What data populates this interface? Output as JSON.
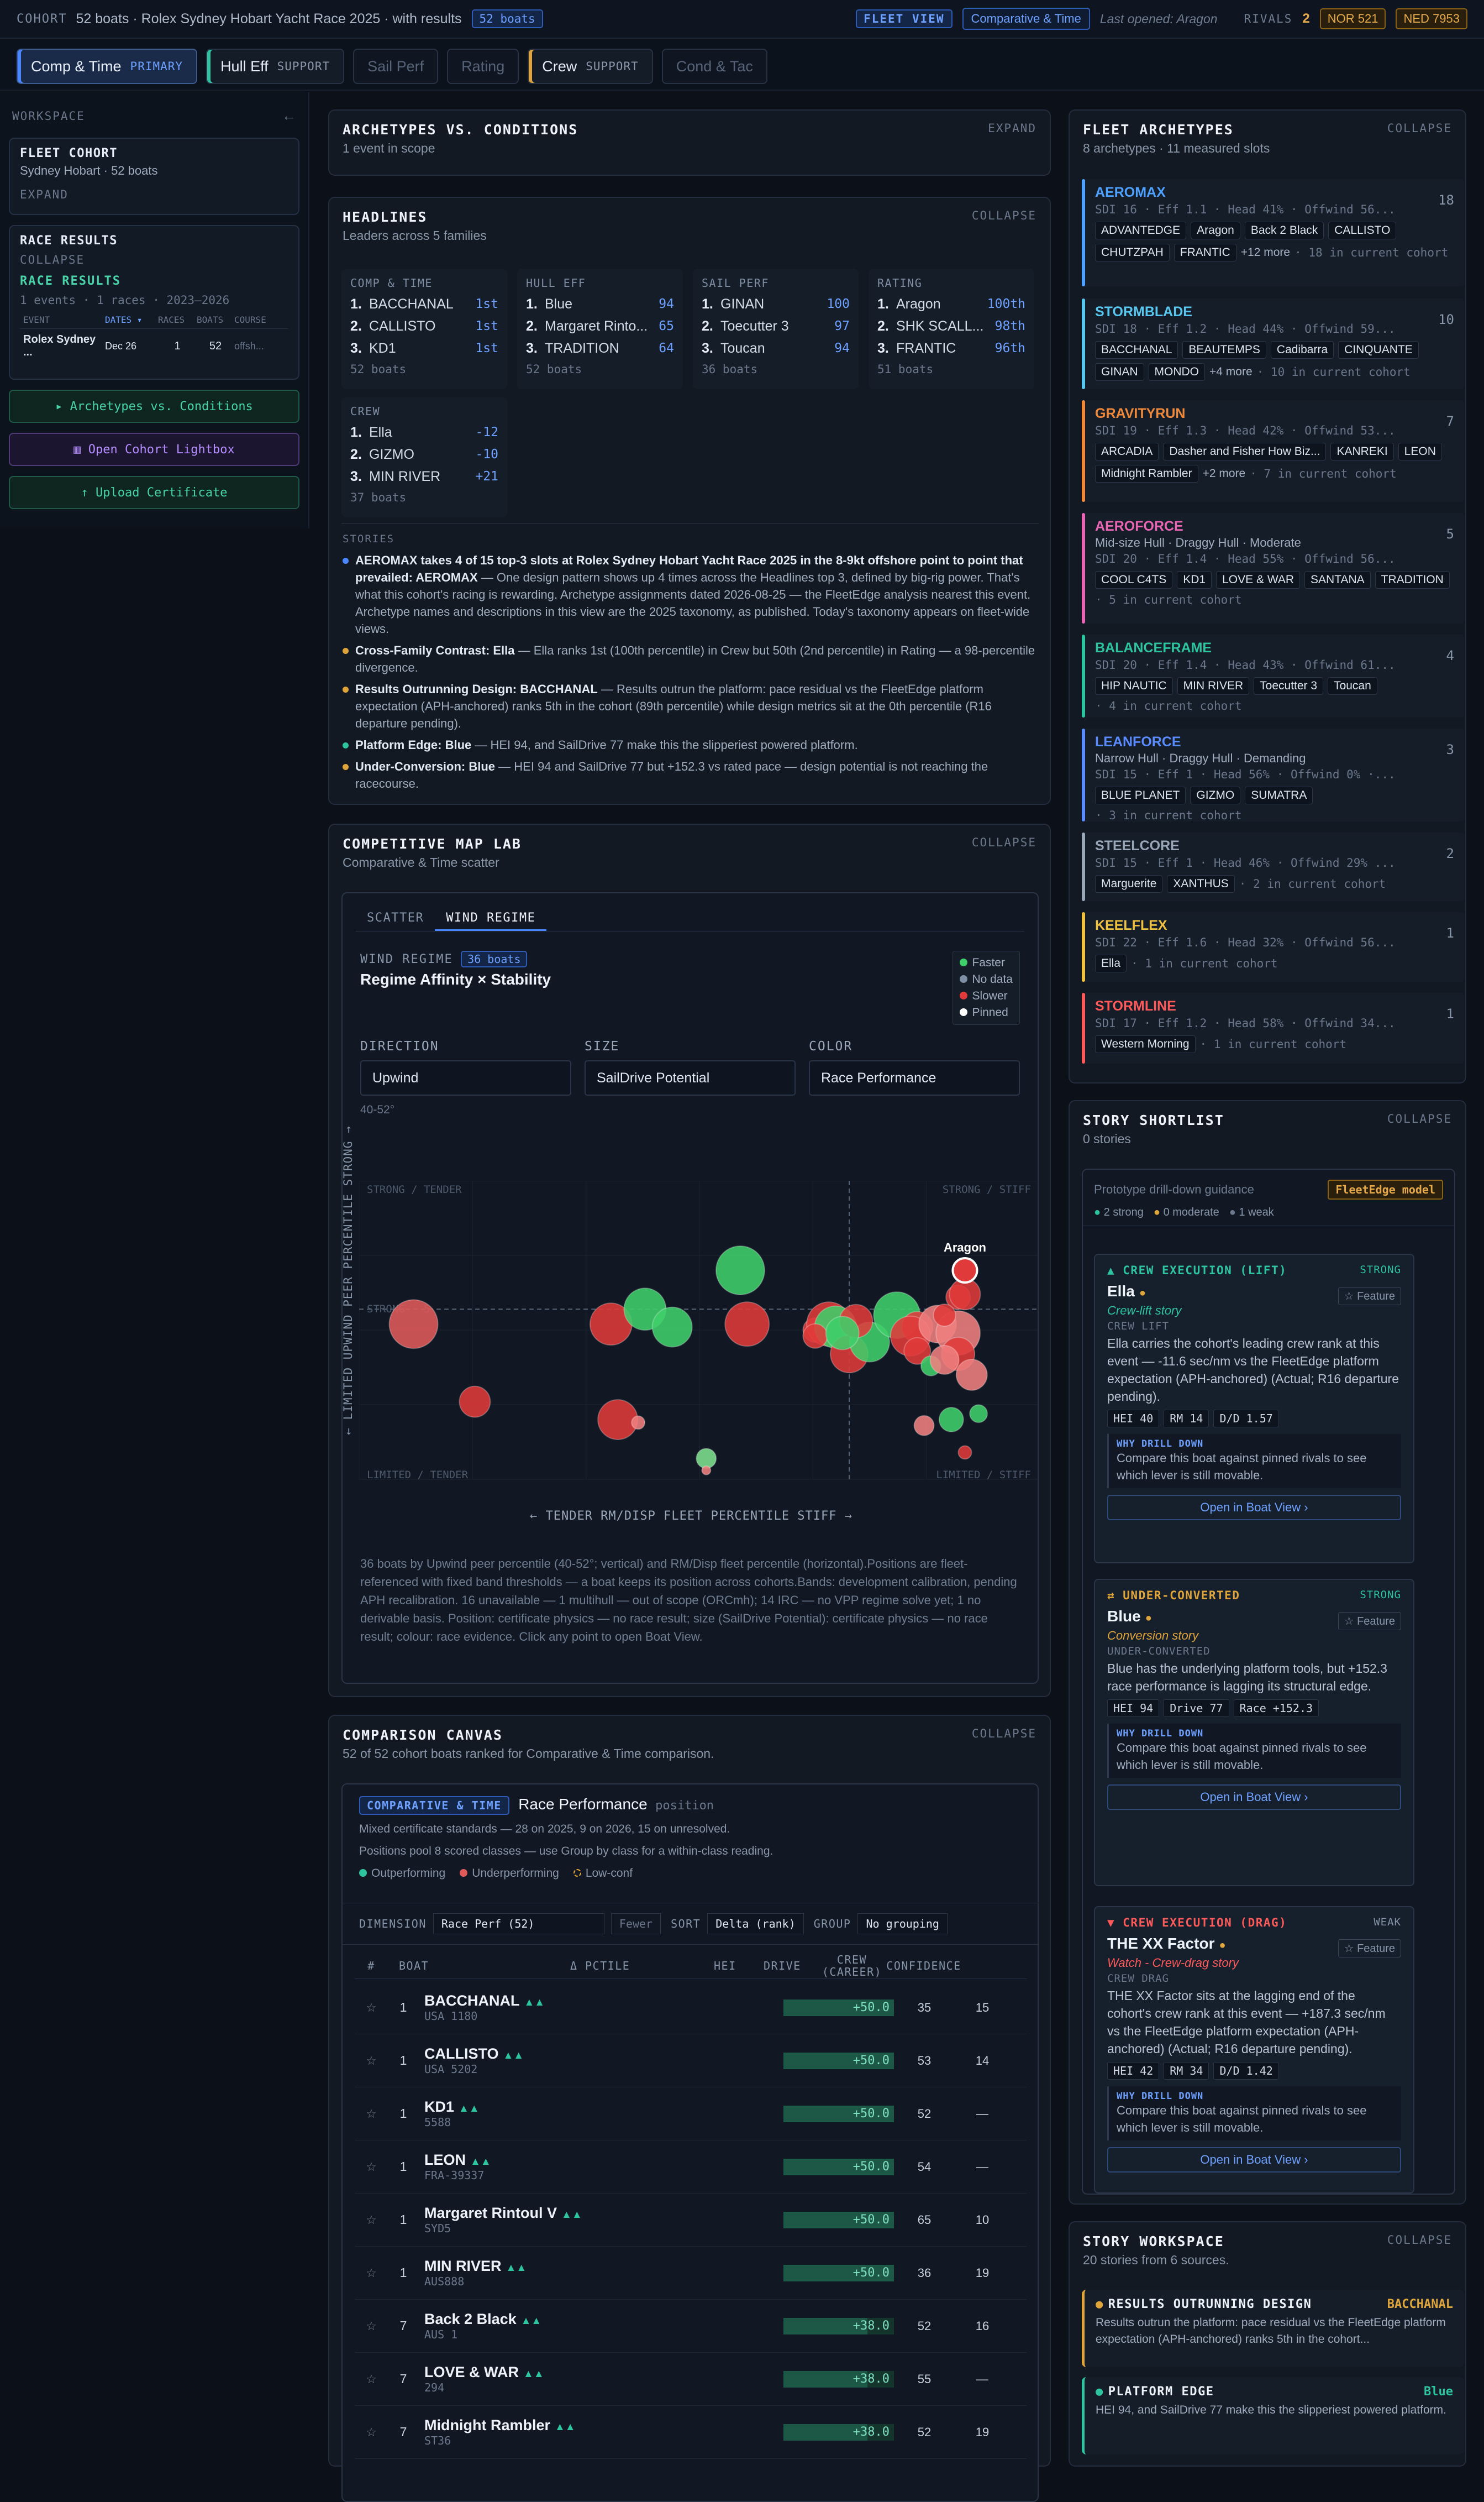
{
  "topbar": {
    "tag": "COHORT",
    "title": "52 boats · Rolex Sydney Hobart Yacht Race 2025 · with results",
    "boats_pill": "52 boats",
    "fleet_view": "FLEET VIEW",
    "comparative": "Comparative & Time",
    "last_opened": "Last opened: Aragon",
    "rivals_label": "RIVALS",
    "rivals_count": "2",
    "rival1": "NOR 521",
    "rival2": "NED 7953"
  },
  "tabs": [
    {
      "label": "Comp & Time",
      "sub": "PRIMARY"
    },
    {
      "label": "Hull Eff",
      "sub": "SUPPORT"
    },
    {
      "label": "Sail Perf",
      "sub": ""
    },
    {
      "label": "Rating",
      "sub": ""
    },
    {
      "label": "Crew",
      "sub": "SUPPORT"
    },
    {
      "label": "Cond & Tac",
      "sub": ""
    }
  ],
  "sidebar": {
    "workspace": "WORKSPACE",
    "collapse_icon": "←",
    "fleet_cohort": {
      "title": "FLEET COHORT",
      "sub": "Sydney Hobart · 52 boats",
      "expand": "EXPAND"
    },
    "race_results": {
      "title": "RACE RESULTS",
      "collapse": "COLLAPSE",
      "label": "RACE RESULTS",
      "meta": "1 events · 1 races · 2023–2026",
      "cols": [
        "EVENT",
        "DATES ▾",
        "RACES",
        "BOATS",
        "COURSE"
      ],
      "row": [
        "Rolex Sydney ...",
        "Dec 26",
        "1",
        "52",
        "offsh..."
      ]
    },
    "btn_archetypes": "▸ Archetypes vs. Conditions",
    "btn_lightbox": "▥ Open Cohort Lightbox",
    "btn_upload": "↑ Upload Certificate"
  },
  "archetypes_panel": {
    "title": "ARCHETYPES VS. CONDITIONS",
    "action": "EXPAND",
    "sub": "1 event in scope"
  },
  "headlines": {
    "title": "HEADLINES",
    "action": "COLLAPSE",
    "sub": "Leaders across 5 families",
    "cards": [
      {
        "h": "COMP & TIME",
        "rows": [
          [
            "1.",
            "BACCHANAL",
            "1st"
          ],
          [
            "2.",
            "CALLISTO",
            "1st"
          ],
          [
            "3.",
            "KD1",
            "1st"
          ]
        ],
        "f": "52 boats"
      },
      {
        "h": "HULL EFF",
        "rows": [
          [
            "1.",
            "Blue",
            "94"
          ],
          [
            "2.",
            "Margaret Rinto...",
            "65"
          ],
          [
            "3.",
            "TRADITION",
            "64"
          ]
        ],
        "f": "52 boats"
      },
      {
        "h": "SAIL PERF",
        "rows": [
          [
            "1.",
            "GINAN",
            "100"
          ],
          [
            "2.",
            "Toecutter 3",
            "97"
          ],
          [
            "3.",
            "Toucan",
            "94"
          ]
        ],
        "f": "36 boats"
      },
      {
        "h": "RATING",
        "rows": [
          [
            "1.",
            "Aragon",
            "100th"
          ],
          [
            "2.",
            "SHK SCALL...",
            "98th"
          ],
          [
            "3.",
            "FRANTIC",
            "96th"
          ]
        ],
        "f": "51 boats"
      },
      {
        "h": "CREW",
        "rows": [
          [
            "1.",
            "Ella",
            "-12"
          ],
          [
            "2.",
            "GIZMO",
            "-10"
          ],
          [
            "3.",
            "MIN RIVER",
            "+21"
          ]
        ],
        "f": "37 boats"
      }
    ],
    "stories_label": "STORIES",
    "stories": [
      {
        "bold": "AEROMAX takes 4 of 15 top-3 slots at Rolex Sydney Hobart Yacht Race 2025 in the 8-9kt offshore point to point that prevailed: AEROMAX",
        "text": " — One design pattern shows up 4 times across the Headlines top 3, defined by big-rig power. That's what this cohort's racing is rewarding. Archetype assignments dated 2026-08-25 — the FleetEdge analysis nearest this event. Archetype names and descriptions in this view are the 2025 taxonomy, as published. Today's taxonomy appears on fleet-wide views.",
        "color": "#4a86ff"
      },
      {
        "bold": "Cross-Family Contrast: Ella",
        "text": " — Ella ranks 1st (100th percentile) in Crew but 50th (2nd percentile) in Rating — a 98-percentile divergence.",
        "color": "#e0a53a"
      },
      {
        "bold": "Results Outrunning Design: BACCHANAL",
        "text": " — Results outrun the platform: pace residual vs the FleetEdge platform expectation (APH-anchored) ranks 5th in the cohort (89th percentile) while design metrics sit at the 0th percentile (R16 departure pending).",
        "color": "#e0a53a"
      },
      {
        "bold": "Platform Edge: Blue",
        "text": " — HEI 94, and SailDrive 77 make this the slipperiest powered platform.",
        "color": "#2ec4a0"
      },
      {
        "bold": "Under-Conversion: Blue",
        "text": " — HEI 94 and SailDrive 77 but +152.3 vs rated pace — design potential is not reaching the racecourse.",
        "color": "#e0a53a"
      }
    ]
  },
  "map": {
    "title": "COMPETITIVE MAP LAB",
    "action": "COLLAPSE",
    "sub": "Comparative & Time scatter",
    "tab1": "SCATTER",
    "tab2": "WIND REGIME",
    "regime_label": "WIND REGIME",
    "regime_count": "36 boats",
    "regime_title": "Regime Affinity × Stability",
    "legend": [
      "Faster",
      "No data",
      "Slower",
      "Pinned"
    ],
    "direction_label": "DIRECTION",
    "direction": "Upwind",
    "size_label": "SIZE",
    "size": "SailDrive Potential",
    "color_label": "COLOR",
    "color": "Race Performance",
    "range": "40-52°",
    "ylabel": "← LIMITED UPWIND PEER PERCENTILE STRONG →",
    "xlabel": "← TENDER RM/DISP FLEET PERCENTILE STIFF →",
    "q_tl": "STRONG / TENDER",
    "q_tr": "STRONG / STIFF",
    "q_bl": "LIMITED / TENDER",
    "q_br": "LIMITED / STIFF",
    "mid": "STRONG · 5",
    "pin_label": "Aragon",
    "note": "36 boats by Upwind peer percentile (40-52°; vertical) and RM/Disp fleet percentile (horizontal).Positions are fleet-referenced with fixed band thresholds — a boat keeps its position across cohorts.Bands: development calibration, pending APH recalibration. 16 unavailable — 1 multihull — out of scope (ORCmh); 14 IRC — no VPP regime solve yet; 1 no derivable basis. Position: certificate physics — no race result; size (SailDrive Potential): certificate physics — no race result; colour: race evidence. Click any point to open Boat View."
  },
  "chart_data": {
    "type": "scatter",
    "xlabel": "TENDER RM/DISP FLEET PERCENTILE STIFF",
    "ylabel": "LIMITED UPWIND PEER PERCENTILE STRONG",
    "xlim": [
      0,
      100
    ],
    "ylim": [
      0,
      100
    ],
    "points": [
      {
        "x": 8,
        "y": 52,
        "r": 44,
        "c": "#e05a5a"
      },
      {
        "x": 37,
        "y": 52,
        "r": 38,
        "c": "#e03a3a"
      },
      {
        "x": 42,
        "y": 57,
        "r": 38,
        "c": "#3fcf6a"
      },
      {
        "x": 46,
        "y": 51,
        "r": 36,
        "c": "#3fcf6a"
      },
      {
        "x": 56,
        "y": 70,
        "r": 44,
        "c": "#3fcf6a"
      },
      {
        "x": 57,
        "y": 52,
        "r": 40,
        "c": "#e03a3a"
      },
      {
        "x": 17,
        "y": 26,
        "r": 28,
        "c": "#e03a3a"
      },
      {
        "x": 38,
        "y": 20,
        "r": 36,
        "c": "#e03a3a"
      },
      {
        "x": 41,
        "y": 19,
        "r": 12,
        "c": "#f08080"
      },
      {
        "x": 51,
        "y": 7,
        "r": 18,
        "c": "#7ee08e"
      },
      {
        "x": 51,
        "y": 3,
        "r": 8,
        "c": "#f08080"
      },
      {
        "x": 67,
        "y": 50,
        "r": 22,
        "c": "#e03a3a"
      },
      {
        "x": 69,
        "y": 52,
        "r": 40,
        "c": "#e03a3a"
      },
      {
        "x": 70,
        "y": 51,
        "r": 38,
        "c": "#3fcf6a"
      },
      {
        "x": 72,
        "y": 42,
        "r": 34,
        "c": "#e03a3a"
      },
      {
        "x": 75,
        "y": 46,
        "r": 36,
        "c": "#3fcf6a"
      },
      {
        "x": 79,
        "y": 55,
        "r": 42,
        "c": "#3fcf6a"
      },
      {
        "x": 82,
        "y": 51,
        "r": 28,
        "c": "#e03a3a"
      },
      {
        "x": 81,
        "y": 48,
        "r": 36,
        "c": "#e03a3a"
      },
      {
        "x": 82,
        "y": 43,
        "r": 24,
        "c": "#e03a3a"
      },
      {
        "x": 85,
        "y": 52,
        "r": 34,
        "c": "#f08080"
      },
      {
        "x": 88,
        "y": 61,
        "r": 22,
        "c": "#e03a3a"
      },
      {
        "x": 88,
        "y": 49,
        "r": 40,
        "c": "#f08080"
      },
      {
        "x": 88,
        "y": 42,
        "r": 30,
        "c": "#e03a3a"
      },
      {
        "x": 84,
        "y": 38,
        "r": 18,
        "c": "#3fcf6a"
      },
      {
        "x": 83,
        "y": 18,
        "r": 18,
        "c": "#f08080"
      },
      {
        "x": 87,
        "y": 20,
        "r": 22,
        "c": "#3fcf6a"
      },
      {
        "x": 91,
        "y": 22,
        "r": 16,
        "c": "#3fcf6a"
      },
      {
        "x": 89,
        "y": 9,
        "r": 12,
        "c": "#e03a3a"
      },
      {
        "x": 67,
        "y": 48,
        "r": 22,
        "c": "#e03a3a"
      },
      {
        "x": 73,
        "y": 53,
        "r": 30,
        "c": "#e03a3a"
      },
      {
        "x": 86,
        "y": 40,
        "r": 26,
        "c": "#f08080"
      },
      {
        "x": 90,
        "y": 35,
        "r": 28,
        "c": "#f08080"
      },
      {
        "x": 86,
        "y": 55,
        "r": 20,
        "c": "#e03a3a"
      },
      {
        "x": 89,
        "y": 62,
        "r": 28,
        "c": "#e03a3a"
      },
      {
        "x": 71,
        "y": 49,
        "r": 30,
        "c": "#3fcf6a"
      }
    ]
  },
  "comparison": {
    "title": "COMPARISON CANVAS",
    "action": "COLLAPSE",
    "sub": "52 of 52 cohort boats ranked for Comparative & Time comparison.",
    "mode": "COMPARATIVE & TIME",
    "metric": "Race Performance",
    "metric_sub": "position",
    "note1": "Mixed certificate standards — 28 on 2025, 9 on 2026, 15 on unresolved.",
    "note2": "Positions pool 8 scored classes — use Group by class for a within-class reading.",
    "leg1": "Outperforming",
    "leg2": "Underperforming",
    "leg3": "Low-conf",
    "dim_label": "DIMENSION",
    "dim": "Race Perf (52)",
    "fewer": "Fewer",
    "sort_label": "SORT",
    "sort": "Delta (rank)",
    "group_label": "GROUP",
    "group": "No grouping",
    "cols": [
      "#",
      "BOAT",
      "Δ PCTILE",
      "HEI",
      "DRIVE",
      "CREW (CAREER)",
      "CONFIDENCE"
    ],
    "rows": [
      {
        "rank": "1",
        "boat": "BACCHANAL",
        "sail": "USA 1180",
        "val": "+50.0",
        "crew": "35",
        "conf": "15",
        "fill": 100
      },
      {
        "rank": "1",
        "boat": "CALLISTO",
        "sail": "USA 5202",
        "val": "+50.0",
        "crew": "53",
        "conf": "14",
        "fill": 100
      },
      {
        "rank": "1",
        "boat": "KD1",
        "sail": "5588",
        "val": "+50.0",
        "crew": "52",
        "conf": "—",
        "fill": 100
      },
      {
        "rank": "1",
        "boat": "LEON",
        "sail": "FRA-39337",
        "val": "+50.0",
        "crew": "54",
        "conf": "—",
        "fill": 100
      },
      {
        "rank": "1",
        "boat": "Margaret Rintoul V",
        "sail": "SYD5",
        "val": "+50.0",
        "crew": "65",
        "conf": "10",
        "fill": 100
      },
      {
        "rank": "1",
        "boat": "MIN RIVER",
        "sail": "AUS888",
        "val": "+50.0",
        "crew": "36",
        "conf": "19",
        "fill": 100
      },
      {
        "rank": "7",
        "boat": "Back 2 Black",
        "sail": "AUS 1",
        "val": "+38.0",
        "crew": "52",
        "conf": "16",
        "fill": 76
      },
      {
        "rank": "7",
        "boat": "LOVE & WAR",
        "sail": "294",
        "val": "+38.0",
        "crew": "55",
        "conf": "—",
        "fill": 76
      },
      {
        "rank": "7",
        "boat": "Midnight Rambler",
        "sail": "ST36",
        "val": "+38.0",
        "crew": "52",
        "conf": "19",
        "fill": 76
      }
    ]
  },
  "fleet_arch": {
    "title": "FLEET ARCHETYPES",
    "action": "COLLAPSE",
    "sub": "8 archetypes · 11 measured slots",
    "items": [
      {
        "name": "AEROMAX",
        "color": "#4ea1ff",
        "meta": "SDI 16 · Eff 1.1 · Head 41% · Offwind 56...",
        "count": "18",
        "chips": [
          "ADVANTEDGE",
          "Aragon",
          "Back 2 Black",
          "CALLISTO",
          "CHUTZPAH",
          "FRANTIC"
        ],
        "more": "+12 more",
        "cur": "18 in current cohort"
      },
      {
        "name": "STORMBLADE",
        "color": "#58c8f0",
        "meta": "SDI 18 · Eff 1.2 · Head 44% · Offwind 59...",
        "count": "10",
        "chips": [
          "BACCHANAL",
          "BEAUTEMPS",
          "Cadibarra",
          "CINQUANTE",
          "GINAN",
          "MONDO"
        ],
        "more": "+4 more",
        "cur": "10 in current cohort"
      },
      {
        "name": "GRAVITYRUN",
        "color": "#f0883a",
        "meta": "SDI 19 · Eff 1.3 · Head 42% · Offwind 53...",
        "count": "7",
        "chips": [
          "ARCADIA",
          "Dasher and Fisher How Biz...",
          "KANREKI",
          "LEON",
          "Midnight Rambler"
        ],
        "more": "+2 more",
        "cur": "7 in current cohort"
      },
      {
        "name": "AEROFORCE",
        "color": "#e866b4",
        "desc": "Mid-size Hull · Draggy Hull · Moderate",
        "meta": "SDI 20 · Eff 1.4 · Head 55% · Offwind 56...",
        "count": "5",
        "chips": [
          "COOL C4TS",
          "KD1",
          "LOVE & WAR",
          "SANTANA",
          "TRADITION"
        ],
        "more": "",
        "cur": "5 in current cohort"
      },
      {
        "name": "BALANCEFRAME",
        "color": "#2ec4a0",
        "meta": "SDI 20 · Eff 1.4 · Head 43% · Offwind 61...",
        "count": "4",
        "chips": [
          "HIP NAUTIC",
          "MIN RIVER",
          "Toecutter 3",
          "Toucan"
        ],
        "more": "",
        "cur": "4 in current cohort"
      },
      {
        "name": "LEANFORCE",
        "color": "#5b8cff",
        "desc": "Narrow Hull · Draggy Hull · Demanding",
        "meta": "SDI 15 · Eff 1 · Head 56% · Offwind 0% ·...",
        "count": "3",
        "chips": [
          "BLUE PLANET",
          "GIZMO",
          "SUMATRA"
        ],
        "more": "",
        "cur": "3 in current cohort"
      },
      {
        "name": "STEELCORE",
        "color": "#9aa7b8",
        "meta": "SDI 15 · Eff 1 · Head 46% · Offwind 29% ...",
        "count": "2",
        "chips": [
          "Marguerite",
          "XANTHUS"
        ],
        "more": "",
        "cur": "2 in current cohort"
      },
      {
        "name": "KEELFLEX",
        "color": "#f0c040",
        "meta": "SDI 22 · Eff 1.6 · Head 32% · Offwind 56...",
        "count": "1",
        "chips": [
          "Ella"
        ],
        "more": "",
        "cur": "1 in current cohort"
      },
      {
        "name": "STORMLINE",
        "color": "#ff5a5a",
        "meta": "SDI 17 · Eff 1.2 · Head 58% · Offwind 34...",
        "count": "1",
        "chips": [
          "Western Morning"
        ],
        "more": "",
        "cur": "1 in current cohort"
      }
    ]
  },
  "shortlist": {
    "title": "STORY SHORTLIST",
    "action": "COLLAPSE",
    "sub": "0 stories",
    "guidance": "Prototype drill-down guidance",
    "model": "FleetEdge model",
    "strong": "2 strong",
    "moderate": "0 moderate",
    "weak": "1 weak",
    "cards": [
      {
        "kind": "▲ CREW EXECUTION (LIFT)",
        "kcolor": "#2ec4a0",
        "strength": "STRONG",
        "boat": "Ella",
        "story": "Crew-lift story",
        "cap": "CREW LIFT",
        "body": "Ella carries the cohort's leading crew rank at this event — -11.6 sec/nm vs the FleetEdge platform expectation (APH-anchored) (Actual; R16 departure pending).",
        "tags": [
          "HEI 40",
          "RM 14",
          "D/D 1.57"
        ],
        "why": "WHY DRILL DOWN",
        "whyd": "Compare this boat against pinned rivals to see which lever is still movable.",
        "open": "Open in Boat View ›",
        "feature": "☆ Feature"
      },
      {
        "kind": "⇄ UNDER-CONVERTED",
        "kcolor": "#e0a53a",
        "strength": "STRONG",
        "boat": "Blue",
        "story": "Conversion story",
        "cap": "UNDER-CONVERTED",
        "body": "Blue has the underlying platform tools, but +152.3 race performance is lagging its structural edge.",
        "tags": [
          "HEI 94",
          "Drive 77",
          "Race +152.3"
        ],
        "why": "WHY DRILL DOWN",
        "whyd": "Compare this boat against pinned rivals to see which lever is still movable.",
        "open": "Open in Boat View ›",
        "feature": "☆ Feature"
      },
      {
        "kind": "▼ CREW EXECUTION (DRAG)",
        "kcolor": "#ff5a5a",
        "strength": "WEAK",
        "boat": "THE XX Factor",
        "story": "Watch - Crew-drag story",
        "cap": "CREW DRAG",
        "body": "THE XX Factor sits at the lagging end of the cohort's crew rank at this event — +187.3 sec/nm vs the FleetEdge platform expectation (APH-anchored) (Actual; R16 departure pending).",
        "tags": [
          "HEI 42",
          "RM 34",
          "D/D 1.42"
        ],
        "why": "WHY DRILL DOWN",
        "whyd": "Compare this boat against pinned rivals to see which lever is still movable.",
        "open": "Open in Boat View ›",
        "feature": "☆ Feature"
      }
    ]
  },
  "workspace": {
    "title": "STORY WORKSPACE",
    "action": "COLLAPSE",
    "sub": "20 stories from 6 sources.",
    "cards": [
      {
        "t": "RESULTS OUTRUNNING DESIGN",
        "r": "BACCHANAL",
        "color": "#e0a53a",
        "d": "Results outrun the platform: pace residual vs the FleetEdge platform expectation (APH-anchored) ranks 5th in the cohort..."
      },
      {
        "t": "PLATFORM EDGE",
        "r": "Blue",
        "color": "#2ec4a0",
        "d": "HEI 94, and SailDrive 77 make this the slipperiest powered platform."
      }
    ]
  }
}
